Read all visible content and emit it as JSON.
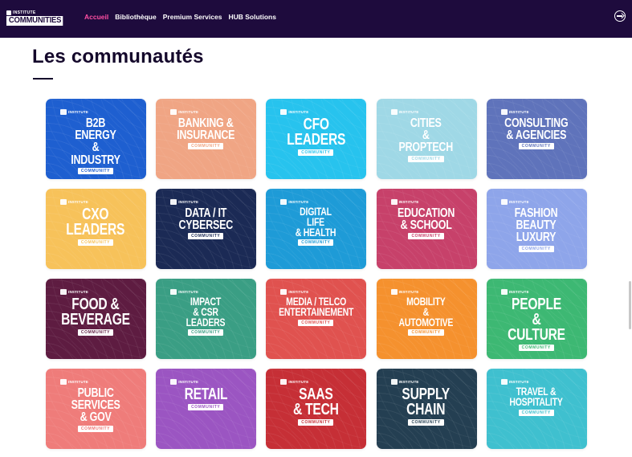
{
  "nav": {
    "logo_small": "INSTITUTE",
    "logo_main": "COMMUNITIES",
    "links": [
      {
        "label": "Accueil",
        "active": true
      },
      {
        "label": "Bibliothèque",
        "active": false
      },
      {
        "label": "Premium Services",
        "active": false
      },
      {
        "label": "HUB Solutions",
        "active": false
      }
    ],
    "logout_icon": "logout-icon"
  },
  "page": {
    "title": "Les communautés"
  },
  "card_common": {
    "institute": "INSTITUTE",
    "badge": "COMMUNITY"
  },
  "cards": [
    {
      "title": "B2B\nENERGY &\nINDUSTRY",
      "color": "#1e5fd0"
    },
    {
      "title": "BANKING &\nINSURANCE",
      "color": "#f0a584"
    },
    {
      "title": "CFO\nLEADERS",
      "color": "#27c3ee"
    },
    {
      "title": "CITIES\n& PROPTECH",
      "color": "#9fd8e6"
    },
    {
      "title": "CONSULTING\n& AGENCIES",
      "color": "#5f73bb"
    },
    {
      "title": "CXO\nLEADERS",
      "color": "#f7c25a"
    },
    {
      "title": "DATA / IT\nCYBERSEC",
      "color": "#1b2a55"
    },
    {
      "title": "DIGITAL LIFE\n& HEALTH",
      "color": "#1e9bd7"
    },
    {
      "title": "EDUCATION\n& SCHOOL",
      "color": "#c7416a"
    },
    {
      "title": "FASHION\nBEAUTY\nLUXURY",
      "color": "#8ea5ea"
    },
    {
      "title": "FOOD &\nBEVERAGE",
      "color": "#5e1c41"
    },
    {
      "title": "IMPACT\n& CSR LEADERS",
      "color": "#3a9e84"
    },
    {
      "title": "MEDIA / TELCO\nENTERTAINEMENT",
      "color": "#e0524f"
    },
    {
      "title": "MOBILITY\n& AUTOMOTIVE",
      "color": "#f5912e"
    },
    {
      "title": "PEOPLE &\nCULTURE",
      "color": "#3db873"
    },
    {
      "title": "PUBLIC\nSERVICES\n& GOV",
      "color": "#ef7c7a"
    },
    {
      "title": "RETAIL",
      "color": "#9b55c2"
    },
    {
      "title": "SAAS\n& TECH",
      "color": "#c62f36"
    },
    {
      "title": "SUPPLY\nCHAIN",
      "color": "#243f52"
    },
    {
      "title": "TRAVEL &\nHOSPITALITY",
      "color": "#3fc0cf"
    }
  ]
}
